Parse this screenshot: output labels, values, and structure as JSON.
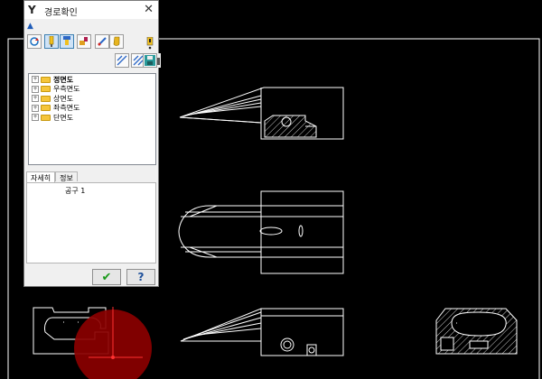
{
  "dialog": {
    "title": "경로확인",
    "close_glyph": "✕",
    "app_icon_glyph": "Y"
  },
  "toolbar": {
    "row1": [
      "refresh-icon",
      "tool-yellow-icon",
      "tool-blue-icon",
      "tool-orange-icon",
      "wand-icon",
      "tool-gold-icon",
      "alert-icon"
    ],
    "row2": [
      "hatch-icon",
      "hatch-icon",
      "camera-icon",
      "save-icon"
    ],
    "collapse_glyph": "▲"
  },
  "tree": {
    "items": [
      {
        "label": "정면도",
        "bold": true
      },
      {
        "label": "우측면도",
        "bold": false
      },
      {
        "label": "상면도",
        "bold": false
      },
      {
        "label": "좌측면도",
        "bold": false
      },
      {
        "label": "단면도",
        "bold": false
      }
    ],
    "expander_glyph": "+"
  },
  "tabs": {
    "items": [
      "자세히",
      "정보"
    ],
    "active": 0
  },
  "panel": {
    "text": "공구 1"
  },
  "buttons": {
    "ok_glyph": "✔",
    "help_glyph": "?"
  },
  "colors": {
    "canvas_bg": "#000000",
    "drawing_lines": "#ffffff",
    "marker": "#8b0000",
    "marker_axis": "#ff3030"
  }
}
